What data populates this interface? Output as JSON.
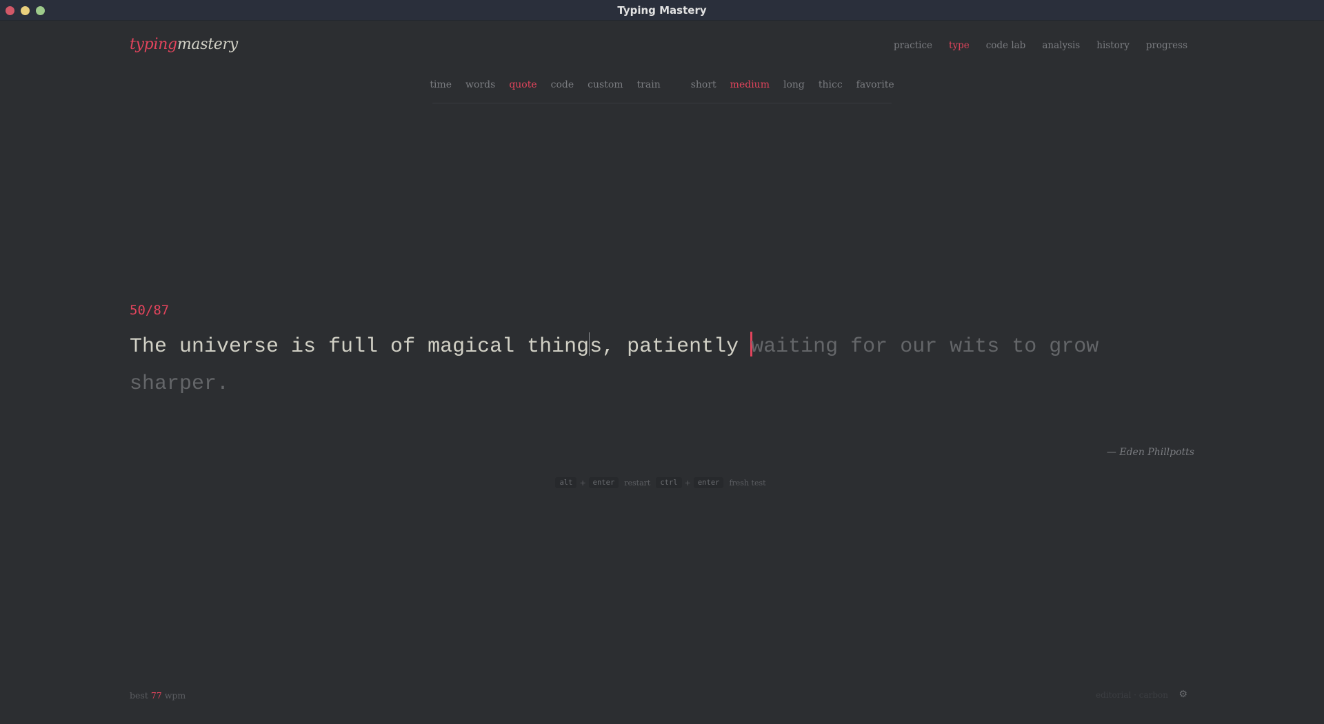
{
  "window": {
    "title": "Typing Mastery",
    "controls": {
      "close_color": "#d25868",
      "minimize_color": "#e9cf7d",
      "maximize_color": "#9ecb8b"
    }
  },
  "header": {
    "logo": {
      "part1": "typing",
      "part2": "mastery"
    },
    "nav": [
      {
        "label": "practice",
        "active": false
      },
      {
        "label": "type",
        "active": true
      },
      {
        "label": "code lab",
        "active": false
      },
      {
        "label": "analysis",
        "active": false
      },
      {
        "label": "history",
        "active": false
      },
      {
        "label": "progress",
        "active": false
      }
    ]
  },
  "modes": [
    {
      "label": "time",
      "active": false
    },
    {
      "label": "words",
      "active": false
    },
    {
      "label": "quote",
      "active": true
    },
    {
      "label": "code",
      "active": false
    },
    {
      "label": "custom",
      "active": false
    },
    {
      "label": "train",
      "active": false
    }
  ],
  "lengths": [
    {
      "label": "short",
      "active": false
    },
    {
      "label": "medium",
      "active": true
    },
    {
      "label": "long",
      "active": false
    },
    {
      "label": "thicc",
      "active": false
    },
    {
      "label": "favorite",
      "active": false
    }
  ],
  "test": {
    "counter": "50/87",
    "typed_a": "The universe is full of magical thing",
    "typed_b": "s, patiently ",
    "untyped": "waiting for our wits to grow sharper.",
    "author": "— Eden Phillpotts"
  },
  "hints": {
    "k1": "alt",
    "plus1": "+",
    "k2": "enter",
    "t1": "restart",
    "k3": "ctrl",
    "plus2": "+",
    "k4": "enter",
    "t2": "fresh test"
  },
  "footer": {
    "best_label": "best",
    "best_value": "77",
    "best_unit": "wpm",
    "theme": "editorial · carbon",
    "settings_icon": "gear-icon"
  },
  "colors": {
    "accent": "#e2445c",
    "background": "#2c2e31",
    "text_typed": "#d1d0c5",
    "text_dim": "#646669"
  }
}
